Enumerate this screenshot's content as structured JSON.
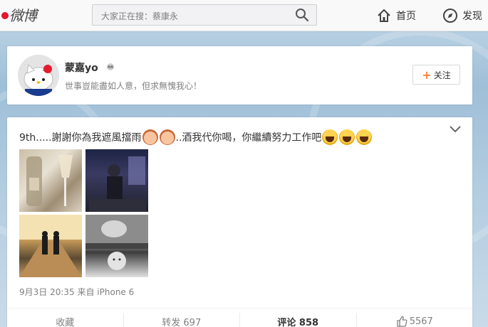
{
  "header": {
    "logo": "微博",
    "search_placeholder": "大家正在搜：蔡康永",
    "nav": [
      {
        "label": "首页",
        "icon": "home-icon"
      },
      {
        "label": "发现",
        "icon": "compass-icon"
      }
    ]
  },
  "profile": {
    "name": "蒙嘉yo",
    "motto": "世事豈能盡如人意，但求無愧我心！",
    "follow_label": "关注"
  },
  "post": {
    "text_part1": "9th.....謝謝你為我遮風擋雨",
    "text_part2": "..酒我代你喝，你繼續努力工作吧",
    "meta": "9月3日 20:35 来自 iPhone 6",
    "actions": {
      "favorite": "收藏",
      "repost": "转发 697",
      "comment": "评论 858",
      "like": "5567"
    }
  },
  "colors": {
    "accent": "#ff8140",
    "text": "#333333",
    "muted": "#808080"
  }
}
